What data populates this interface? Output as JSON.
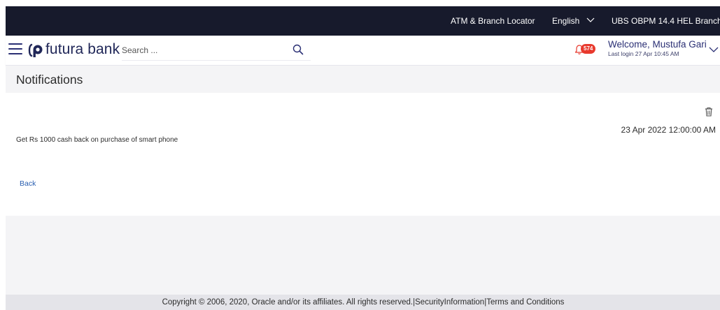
{
  "topbar": {
    "locator_label": "ATM & Branch Locator",
    "language_label": "English",
    "branch_label": "UBS OBPM 14.4 HEL Branch",
    "background_color": "#171a2c"
  },
  "header": {
    "brand_name": "futura bank",
    "search_placeholder": "Search ...",
    "notification_count": "574",
    "welcome_text": "Welcome, Mustufa Gari",
    "last_login_text": "Last login 27 Apr 10:45 AM",
    "brand_color": "#2a2f74",
    "badge_color": "#e8392d"
  },
  "page": {
    "title": "Notifications"
  },
  "notification": {
    "message": "Get Rs 1000 cash back on purchase of smart  phone",
    "datetime": "23 Apr 2022 12:00:00 AM",
    "back_label": "Back",
    "delete_icon": "trash-icon"
  },
  "footer": {
    "copyright": "Copyright © 2006, 2020, Oracle and/or its affiliates. All rights reserved.",
    "separator": "|",
    "security_link": "SecurityInformation",
    "terms_link": "Terms and Conditions"
  }
}
